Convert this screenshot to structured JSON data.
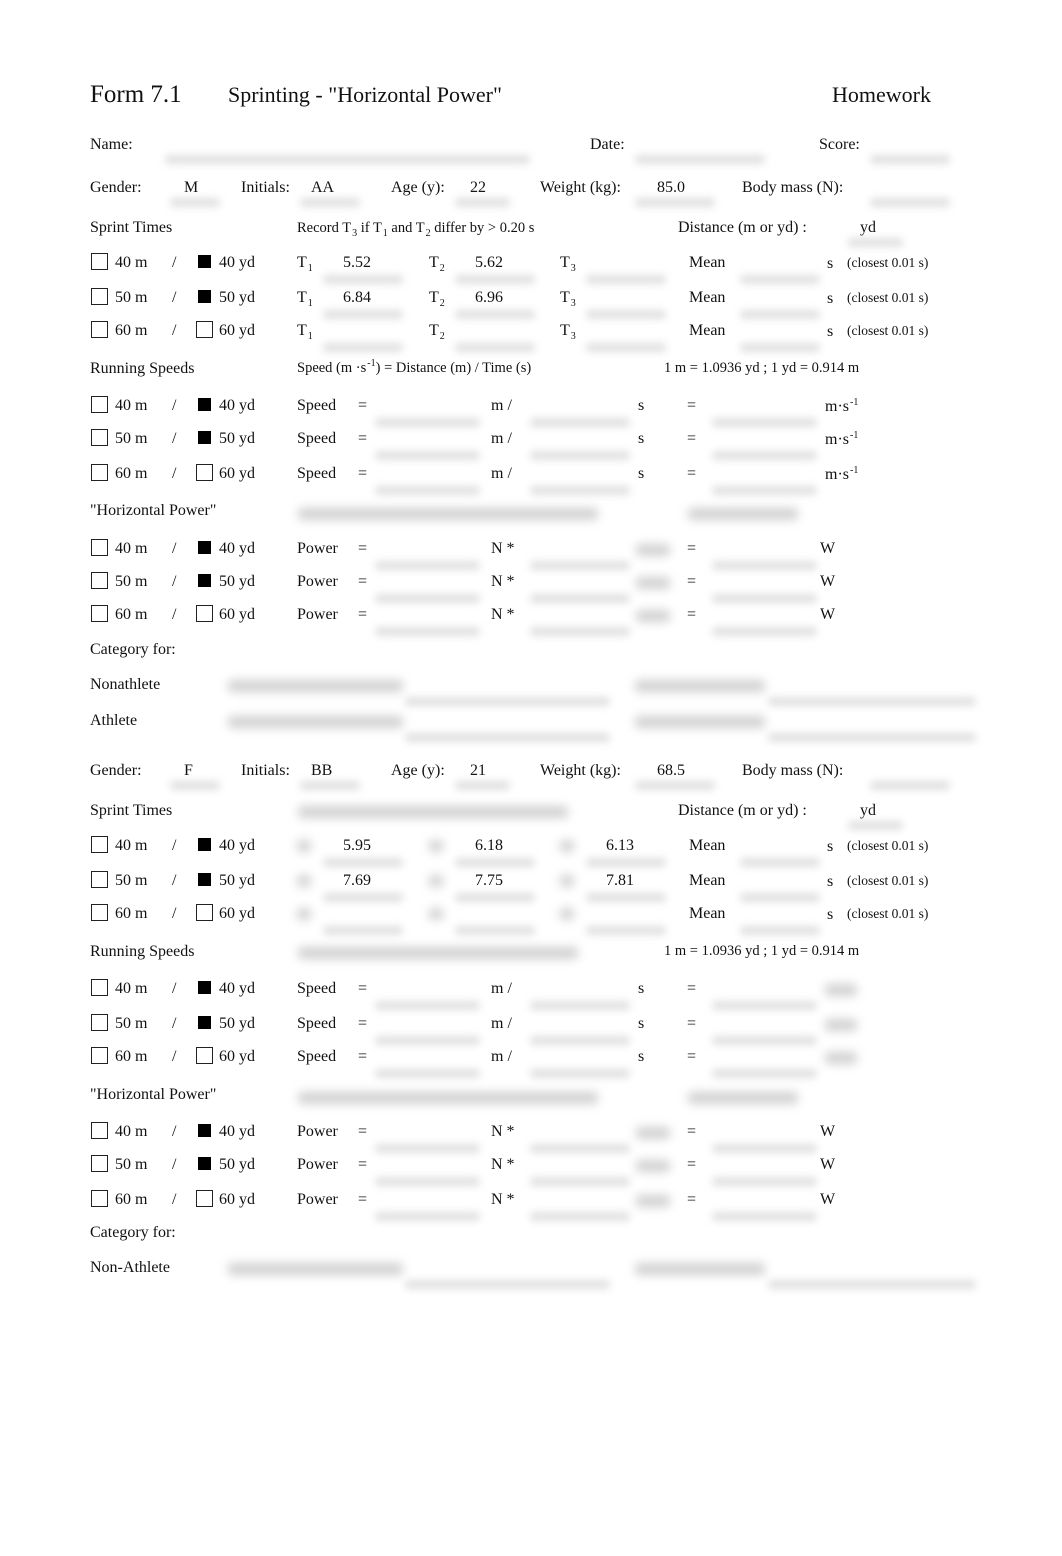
{
  "header": {
    "form_number": "Form 7.1",
    "title": "Sprinting - \"Horizontal Power\"",
    "right_label": "Homework"
  },
  "meta": {
    "name_label": "Name:",
    "date_label": "Date:",
    "score_label": "Score:"
  },
  "labels": {
    "gender": "Gender:",
    "initials": "Initials:",
    "age": "Age (y):",
    "weight": "Weight (kg):",
    "body_mass": "Body mass (N):",
    "sprint_times": "Sprint Times",
    "record_note_pre": "Record T",
    "record_note_sub3": "3",
    "record_note_mid1": " if T",
    "record_note_sub1": "1",
    "record_note_mid2": " and T",
    "record_note_sub2": "2",
    "record_note_post": " differ by > 0.20 s",
    "distance": "Distance (m or yd) :",
    "distance_unit": "yd",
    "t1": "T",
    "t2": "T",
    "t3": "T",
    "sub1": "1",
    "sub2": "2",
    "sub3": "3",
    "mean": "Mean",
    "s": "s",
    "closest": "(closest 0.01 s)",
    "running_speeds": "Running Speeds",
    "speed_formula_pre": "Speed (m  ·s",
    "speed_formula_sup": "-1",
    "speed_formula_post": ")  =  Distance (m) / Time (s)",
    "conversion": "1 m = 1.0936 yd ; 1 yd = 0.914 m",
    "speed": "Speed",
    "equals": "=",
    "m_slash": "m  /",
    "ms_unit": "m·s",
    "ms_sup": "-1",
    "horizontal_power": "\"Horizontal Power\"",
    "power": "Power",
    "n_star": "N  *",
    "w": "W",
    "category_for": "Category for:",
    "slash": "/"
  },
  "distance_rows": [
    {
      "m_label": "40 m",
      "yd_label": "40 yd",
      "m_checked": false,
      "yd_checked": true
    },
    {
      "m_label": "50 m",
      "yd_label": "50 yd",
      "m_checked": false,
      "yd_checked": true
    },
    {
      "m_label": "60 m",
      "yd_label": "60 yd",
      "m_checked": false,
      "yd_checked": false
    }
  ],
  "subjects": [
    {
      "gender": "M",
      "initials": "AA",
      "age": "22",
      "weight": "85.0",
      "times": [
        {
          "t1": "5.52",
          "t2": "5.62",
          "t3": ""
        },
        {
          "t1": "6.84",
          "t2": "6.96",
          "t3": ""
        },
        {
          "t1": "",
          "t2": "",
          "t3": ""
        }
      ],
      "categories": [
        "Nonathlete",
        "Athlete"
      ]
    },
    {
      "gender": "F",
      "initials": "BB",
      "age": "21",
      "weight": "68.5",
      "times": [
        {
          "t1": "5.95",
          "t2": "6.18",
          "t3": "6.13"
        },
        {
          "t1": "7.69",
          "t2": "7.75",
          "t3": "7.81"
        },
        {
          "t1": "",
          "t2": "",
          "t3": ""
        }
      ],
      "categories": [
        "Non-Athlete"
      ]
    }
  ]
}
